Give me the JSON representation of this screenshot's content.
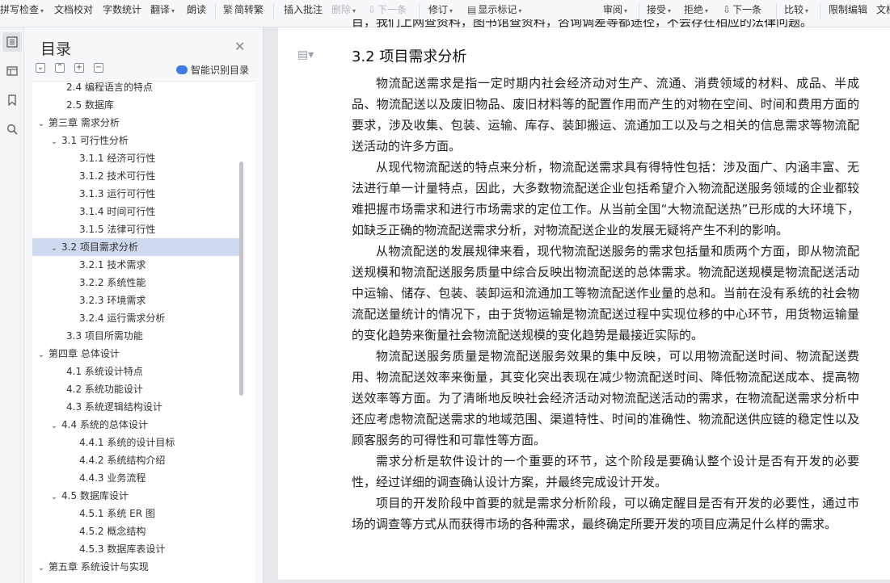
{
  "toolbar": {
    "spell_check": "拼写检查",
    "doc_proofread": "文档校对",
    "word_count": "字数统计",
    "translate": "翻译",
    "read_aloud": "朗读",
    "simp_trad": "简转繁",
    "insert_comment": "插入批注",
    "delete": "删除",
    "next": "下一条",
    "revise": "修订",
    "show_marks": "显示标记",
    "review": "审阅",
    "accept": "接受",
    "reject": "拒绝",
    "next2": "下一条",
    "compare": "比较",
    "restrict_edit": "限制编辑",
    "doc_more": "文档"
  },
  "outline": {
    "title": "目录",
    "smart_recognize": "智能识别目录",
    "items": [
      {
        "label": "2.4 编程语言的特点",
        "level": 2,
        "arrow": ""
      },
      {
        "label": "2.5 数据库",
        "level": 2,
        "arrow": ""
      },
      {
        "label": "第三章 需求分析",
        "level": 1,
        "arrow": "⌄"
      },
      {
        "label": "3.1 可行性分析",
        "level": 2,
        "arrow": "⌄"
      },
      {
        "label": "3.1.1 经济可行性",
        "level": 3,
        "arrow": ""
      },
      {
        "label": "3.1.2 技术可行性",
        "level": 3,
        "arrow": ""
      },
      {
        "label": "3.1.3 运行可行性",
        "level": 3,
        "arrow": ""
      },
      {
        "label": "3.1.4 时间可行性",
        "level": 3,
        "arrow": ""
      },
      {
        "label": "3.1.5 法律可行性",
        "level": 3,
        "arrow": ""
      },
      {
        "label": "3.2 项目需求分析",
        "level": 2,
        "arrow": "⌄",
        "selected": true
      },
      {
        "label": "3.2.1 技术需求",
        "level": 3,
        "arrow": ""
      },
      {
        "label": "3.2.2 系统性能",
        "level": 3,
        "arrow": ""
      },
      {
        "label": "3.2.3 环境需求",
        "level": 3,
        "arrow": ""
      },
      {
        "label": "3.2.4 运行需求分析",
        "level": 3,
        "arrow": ""
      },
      {
        "label": "3.3 项目所需功能",
        "level": 2,
        "arrow": ""
      },
      {
        "label": "第四章 总体设计",
        "level": 1,
        "arrow": "⌄"
      },
      {
        "label": "4.1 系统设计特点",
        "level": 2,
        "arrow": ""
      },
      {
        "label": "4.2 系统功能设计",
        "level": 2,
        "arrow": ""
      },
      {
        "label": "4.3 系统逻辑结构设计",
        "level": 2,
        "arrow": ""
      },
      {
        "label": "4.4 系统的总体设计",
        "level": 2,
        "arrow": "⌄"
      },
      {
        "label": "4.4.1 系统的设计目标",
        "level": 3,
        "arrow": ""
      },
      {
        "label": "4.4.2 系统结构介绍",
        "level": 3,
        "arrow": ""
      },
      {
        "label": "4.4.3 业务流程",
        "level": 3,
        "arrow": ""
      },
      {
        "label": "4.5 数据库设计",
        "level": 2,
        "arrow": "⌄"
      },
      {
        "label": "4.5.1 系统 ER 图",
        "level": 3,
        "arrow": ""
      },
      {
        "label": "4.5.2 概念结构",
        "level": 3,
        "arrow": ""
      },
      {
        "label": "4.5.3 数据库表设计",
        "level": 3,
        "arrow": ""
      },
      {
        "label": "第五章 系统设计与实现",
        "level": 1,
        "arrow": "⌄"
      }
    ]
  },
  "document": {
    "top_line": "目，我们上网查资料，图书馆查资料，咨询调差等都途径，不会存在相应的法律问题。",
    "heading": "3.2 项目需求分析",
    "paragraphs": [
      "物流配送需求是指一定时期内社会经济动对生产、流通、消费领域的材料、成品、半成品、物流配送以及废旧物品、废旧材料等的配置作用而产生的对物在空间、时间和费用方面的要求，涉及收集、包装、运输、库存、装卸搬运、流通加工以及与之相关的信息需求等物流配送活动的许多方面。",
      "从现代物流配送的特点来分析，物流配送需求具有得特性包括：涉及面广、内涵丰富、无法进行单一计量特点，因此，大多数物流配送企业包括希望介入物流配送服务领域的企业都较难把握市场需求和进行市场需求的定位工作。从当前全国“大物流配送热”已形成的大环境下，如缺乏正确的物流配送需求分析，对物流配送企业的发展无疑将产生不利的影响。",
      "从物流配送的发展规律来看，现代物流配送服务的需求包括量和质两个方面，即从物流配送规模和物流配送服务质量中综合反映出物流配送的总体需求。物流配送规模是物流配送活动中运输、储存、包装、装卸运和流通加工等物流配送作业量的总和。当前在没有系统的社会物流配送量统计的情况下，由于货物运输是物流配送过程中实现位移的中心环节，用货物运输量的变化趋势来衡量社会物流配送规模的变化趋势是最接近实际的。",
      "物流配送服务质量是物流配送服务效果的集中反映，可以用物流配送时间、物流配送费用、物流配送效率来衡量，其变化突出表现在减少物流配送时间、降低物流配送成本、提高物送效率等方面。为了清晰地反映社会经济活动对物流配送活动的需求，在物流配送需求分析中还应考虑物流配送需求的地域范围、渠道特性、时间的准确性、物流配送供应链的稳定性以及顾客服务的可得性和可靠性等方面。",
      "需求分析是软件设计的一个重要的环节，这个阶段是要确认整个设计是否有开发的必要性，经过详细的调查确认设计方案，并最终完成设计开发。",
      "项目的开发阶段中首要的就是需求分析阶段，可以确定醒目是否有开发的必要性，通过市场的调查等方式从而获得市场的各种需求，最终确定所要开发的项目应满足什么样的需求。"
    ]
  }
}
